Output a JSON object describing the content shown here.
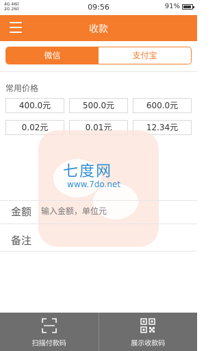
{
  "status_bar": {
    "signal_left": "4G 46il\n2G 26il",
    "time": "09:56",
    "battery": "91%"
  },
  "header": {
    "title": "收款"
  },
  "tabs": [
    {
      "label": "微信",
      "active": true
    },
    {
      "label": "支付宝",
      "active": false
    }
  ],
  "common_prices": {
    "label": "常用价格",
    "amounts": [
      "400.0元",
      "500.0元",
      "600.0元",
      "0.02元",
      "0.01元",
      "12.34元"
    ]
  },
  "watermark": {
    "title": "七度网",
    "url": "www.7do.net"
  },
  "form": {
    "amount_label": "金额",
    "amount_placeholder": "输入金额，单位元",
    "note_label": "备注",
    "note_placeholder": ""
  },
  "bottom_bar": {
    "scan_label": "扫描付款码",
    "show_label": "展示收款码"
  },
  "colors": {
    "accent": "#f57c2b",
    "bottom_bar": "#6e6e6e"
  }
}
